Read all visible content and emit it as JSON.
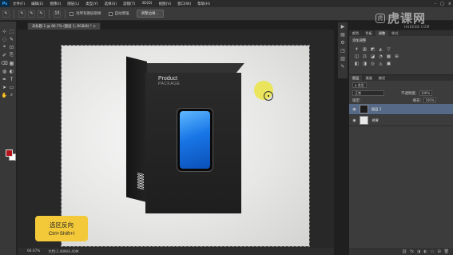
{
  "app": {
    "logo": "Ps"
  },
  "menu": [
    "文件(F)",
    "编辑(E)",
    "图像(I)",
    "图层(L)",
    "类型(Y)",
    "选择(S)",
    "滤镜(T)",
    "3D(D)",
    "视图(V)",
    "窗口(W)",
    "帮助(H)"
  ],
  "window_controls": {
    "minimize": "–",
    "maximize": "□",
    "close": "×"
  },
  "options": {
    "tool_icon": "✎",
    "mode_icons": [
      "✎",
      "✎",
      "✎"
    ],
    "brush_size": "15",
    "sample_all_layers": "对所有图层取样",
    "auto_enhance": "自动增强",
    "refine_edge": "调整边缘..."
  },
  "watermark": {
    "mark": "虎",
    "text": "虎课网",
    "sub": "HUKE88.COM"
  },
  "document": {
    "tab": "未标题-1 @ 66.7% (图层 1, RGB/8) * ×",
    "zoom": "66.67%",
    "doc_info": "文档:2.40M/4.40M"
  },
  "artwork": {
    "title": "Product",
    "subtitle": "PACKAGE"
  },
  "hint": {
    "title": "选区反向",
    "keys": "Ctrl+Shift+I"
  },
  "tools": [
    "⊹",
    "⬚",
    "◌",
    "✎",
    "⌖",
    "⊡",
    "✐",
    "⎘",
    "⌫",
    "▦",
    "◍",
    "◐",
    "✒",
    "T",
    "➤",
    "▭",
    "✋",
    "⌕"
  ],
  "dock_icons": [
    "▶",
    "▤",
    "⚙",
    "◳",
    "▥",
    "✎"
  ],
  "adjustments": {
    "tabs": [
      "颜色",
      "色板",
      "调整",
      "样式"
    ],
    "title": "添加调整",
    "row1": [
      "☀",
      "▥",
      "◩",
      "◭",
      "▽"
    ],
    "row2": [
      "◫",
      "⚖",
      "◪",
      "◔",
      "▦",
      "⊞"
    ],
    "row3": [
      "◧",
      "◨",
      "◎",
      "◬",
      "▣"
    ]
  },
  "layers": {
    "tabs": [
      "图层",
      "通道",
      "路径"
    ],
    "filter_label": "ρ 类型",
    "blend_mode": "正常",
    "opacity_label": "不透明度:",
    "opacity": "100%",
    "lock_label": "锁定:",
    "fill_label": "填充:",
    "fill": "100%",
    "items": [
      {
        "name": "图层 1",
        "visible_icon": "◉",
        "selected": true
      },
      {
        "name": "背景",
        "visible_icon": "◉",
        "selected": false
      }
    ],
    "footer_icons": [
      "⛓",
      "fx",
      "◑",
      "◐",
      "▭",
      "⊞",
      "🗑"
    ]
  }
}
